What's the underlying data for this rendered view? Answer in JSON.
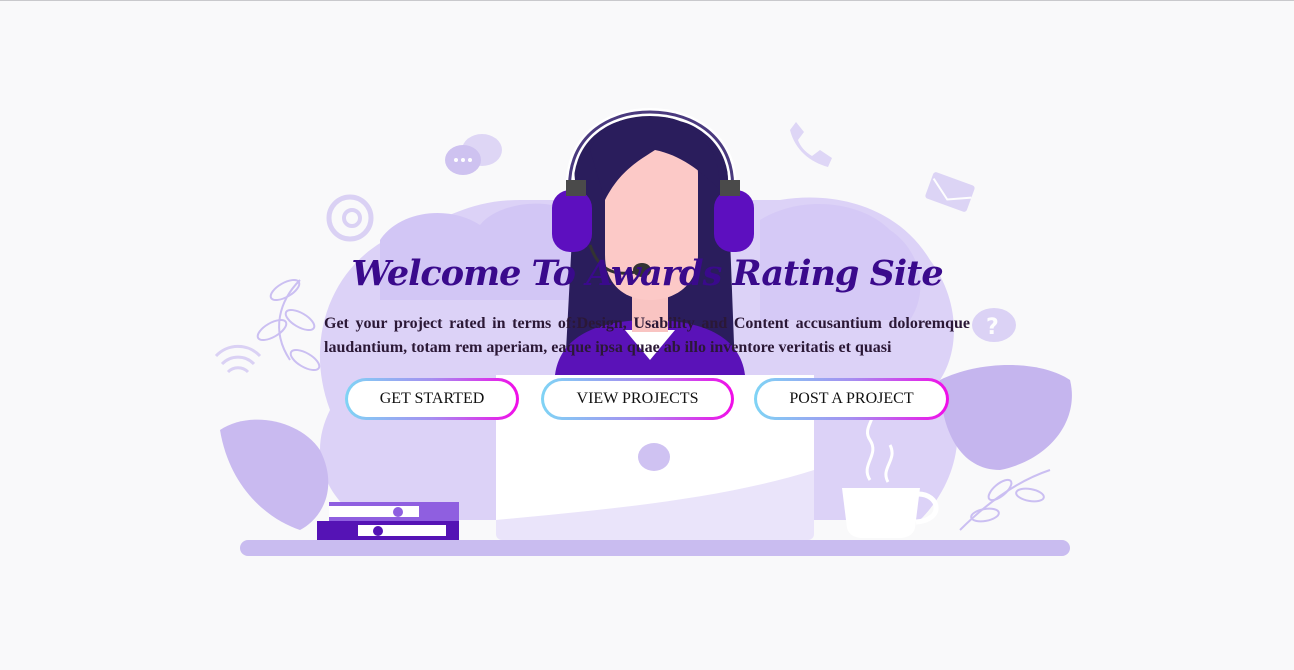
{
  "hero": {
    "title": "Welcome To Awards Rating Site",
    "subtitle": "Get your project rated in terms of:Design, Usability and Content accusantium doloremque laudantium, totam rem aperiam, eaque ipsa quae ab illo inventore veritatis et quasi"
  },
  "buttons": {
    "get_started": "GET STARTED",
    "view_projects": "VIEW PROJECTS",
    "post_project": "POST A PROJECT"
  },
  "illustration": {
    "depicts": "customer-support-headset-woman-at-laptop",
    "icons": [
      "chat-bubbles-icon",
      "at-sign-icon",
      "wifi-icon",
      "phone-icon",
      "envelope-icon",
      "question-icon",
      "coffee-cup-icon",
      "books-icon",
      "leaf-icon"
    ]
  },
  "colors": {
    "background": "#f9f9fa",
    "title": "#3a0a8c",
    "text": "#2b1836",
    "illustration_light": "#dcd2f7",
    "illustration_mid": "#c7b8ef",
    "illustration_dark": "#5a12b8",
    "button_gradient_start": "#7fd4f5",
    "button_gradient_end": "#f20ce8"
  }
}
